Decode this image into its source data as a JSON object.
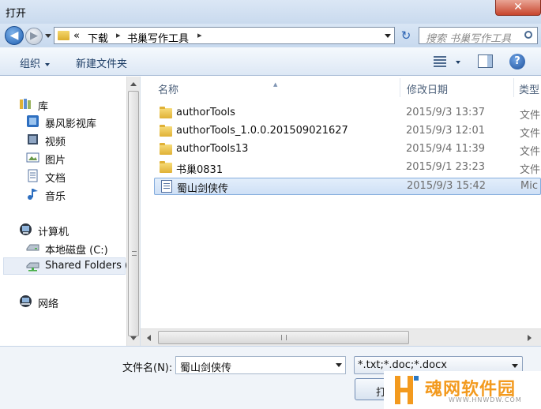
{
  "window": {
    "title": "打开",
    "close_glyph": "✕"
  },
  "address_bar": {
    "back_glyph": "◀",
    "forward_glyph": "▶",
    "overflow": "«",
    "segments": [
      "下载",
      "书巢写作工具"
    ],
    "separator": "▸",
    "refresh_glyph": "↻",
    "search_placeholder": "搜索 书巢写作工具"
  },
  "toolbar": {
    "organize_label": "组织",
    "new_folder_label": "新建文件夹",
    "help_glyph": "?"
  },
  "nav": {
    "libraries_label": "库",
    "libraries": [
      "暴风影视库",
      "视频",
      "图片",
      "文档",
      "音乐"
    ],
    "computer_label": "计算机",
    "drives": [
      "本地磁盘 (C:)",
      "Shared Folders ("
    ],
    "network_label": "网络"
  },
  "columns": {
    "name": "名称",
    "modified": "修改日期",
    "type": "类型"
  },
  "files": [
    {
      "name": "authorTools",
      "date": "2015/9/3 13:37",
      "type": "文件",
      "icon": "folder-icon"
    },
    {
      "name": "authorTools_1.0.0.201509021627",
      "date": "2015/9/3 12:01",
      "type": "文件",
      "icon": "folder-icon"
    },
    {
      "name": "authorTools13",
      "date": "2015/9/4 11:39",
      "type": "文件",
      "icon": "folder-icon"
    },
    {
      "name": "书巢0831",
      "date": "2015/9/1 23:23",
      "type": "文件",
      "icon": "folder-icon"
    },
    {
      "name": "蜀山剑侠传",
      "date": "2015/9/3 15:42",
      "type": "Mic",
      "icon": "document-icon",
      "selected": true
    }
  ],
  "bottom": {
    "filename_label": "文件名(N):",
    "filename_value": "蜀山剑侠传",
    "filter_value": "*.txt;*.doc;*.docx",
    "open_label": "打"
  },
  "watermark": {
    "text": "魂网软件园",
    "sub": "WWW.HNWDW.COM"
  },
  "colors": {
    "accent": "#2b62b2",
    "selection": "#cfe0f6",
    "watermark": "#f39a1e"
  }
}
